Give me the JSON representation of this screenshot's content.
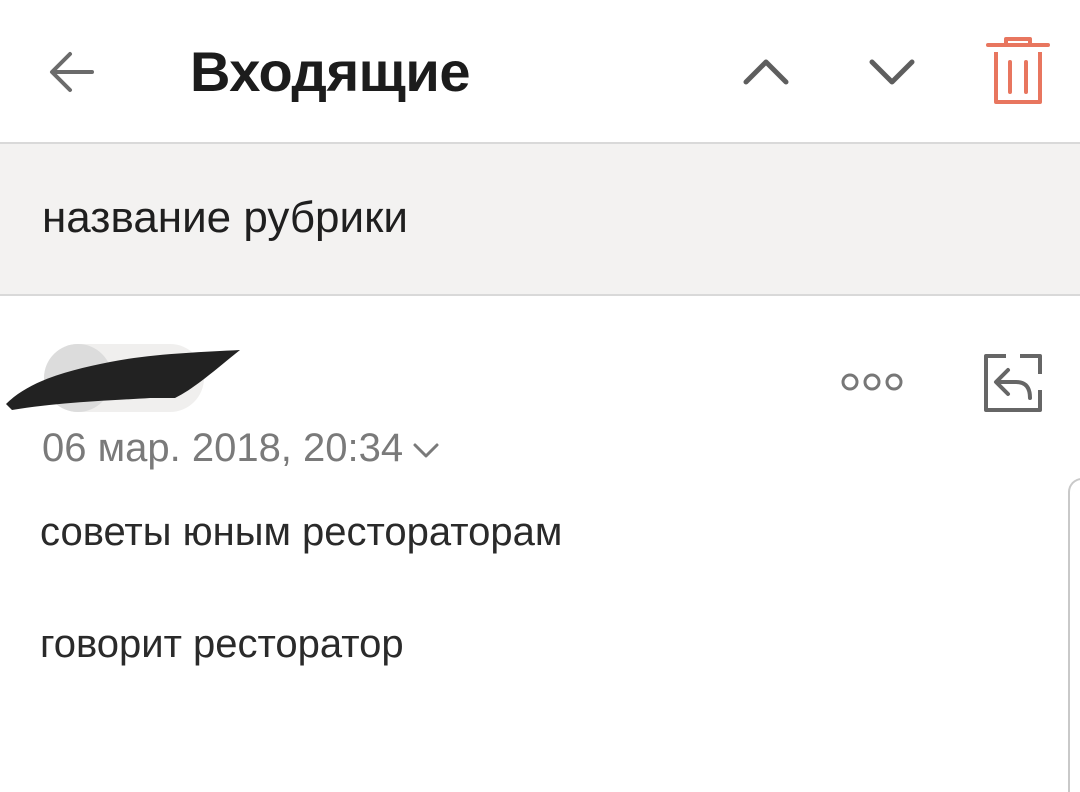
{
  "header": {
    "title": "Входящие",
    "icons": {
      "back": "arrow-left-icon",
      "prev": "chevron-up-icon",
      "next": "chevron-down-icon",
      "delete": "trash-icon"
    },
    "delete_color": "#e8765f"
  },
  "category": {
    "label": "название рубрики"
  },
  "message": {
    "date": "06 мар. 2018, 20:34",
    "icons": {
      "more": "more-dots-icon",
      "reply": "reply-icon",
      "date_toggle": "chevron-down-icon"
    },
    "body_lines": [
      "советы юным рестораторам",
      "говорит ресторатор"
    ]
  },
  "colors": {
    "category_bg": "#f3f2f1",
    "icon_gray": "#666666",
    "text_dark": "#1c1c1c",
    "date_gray": "#7a7a7a"
  }
}
